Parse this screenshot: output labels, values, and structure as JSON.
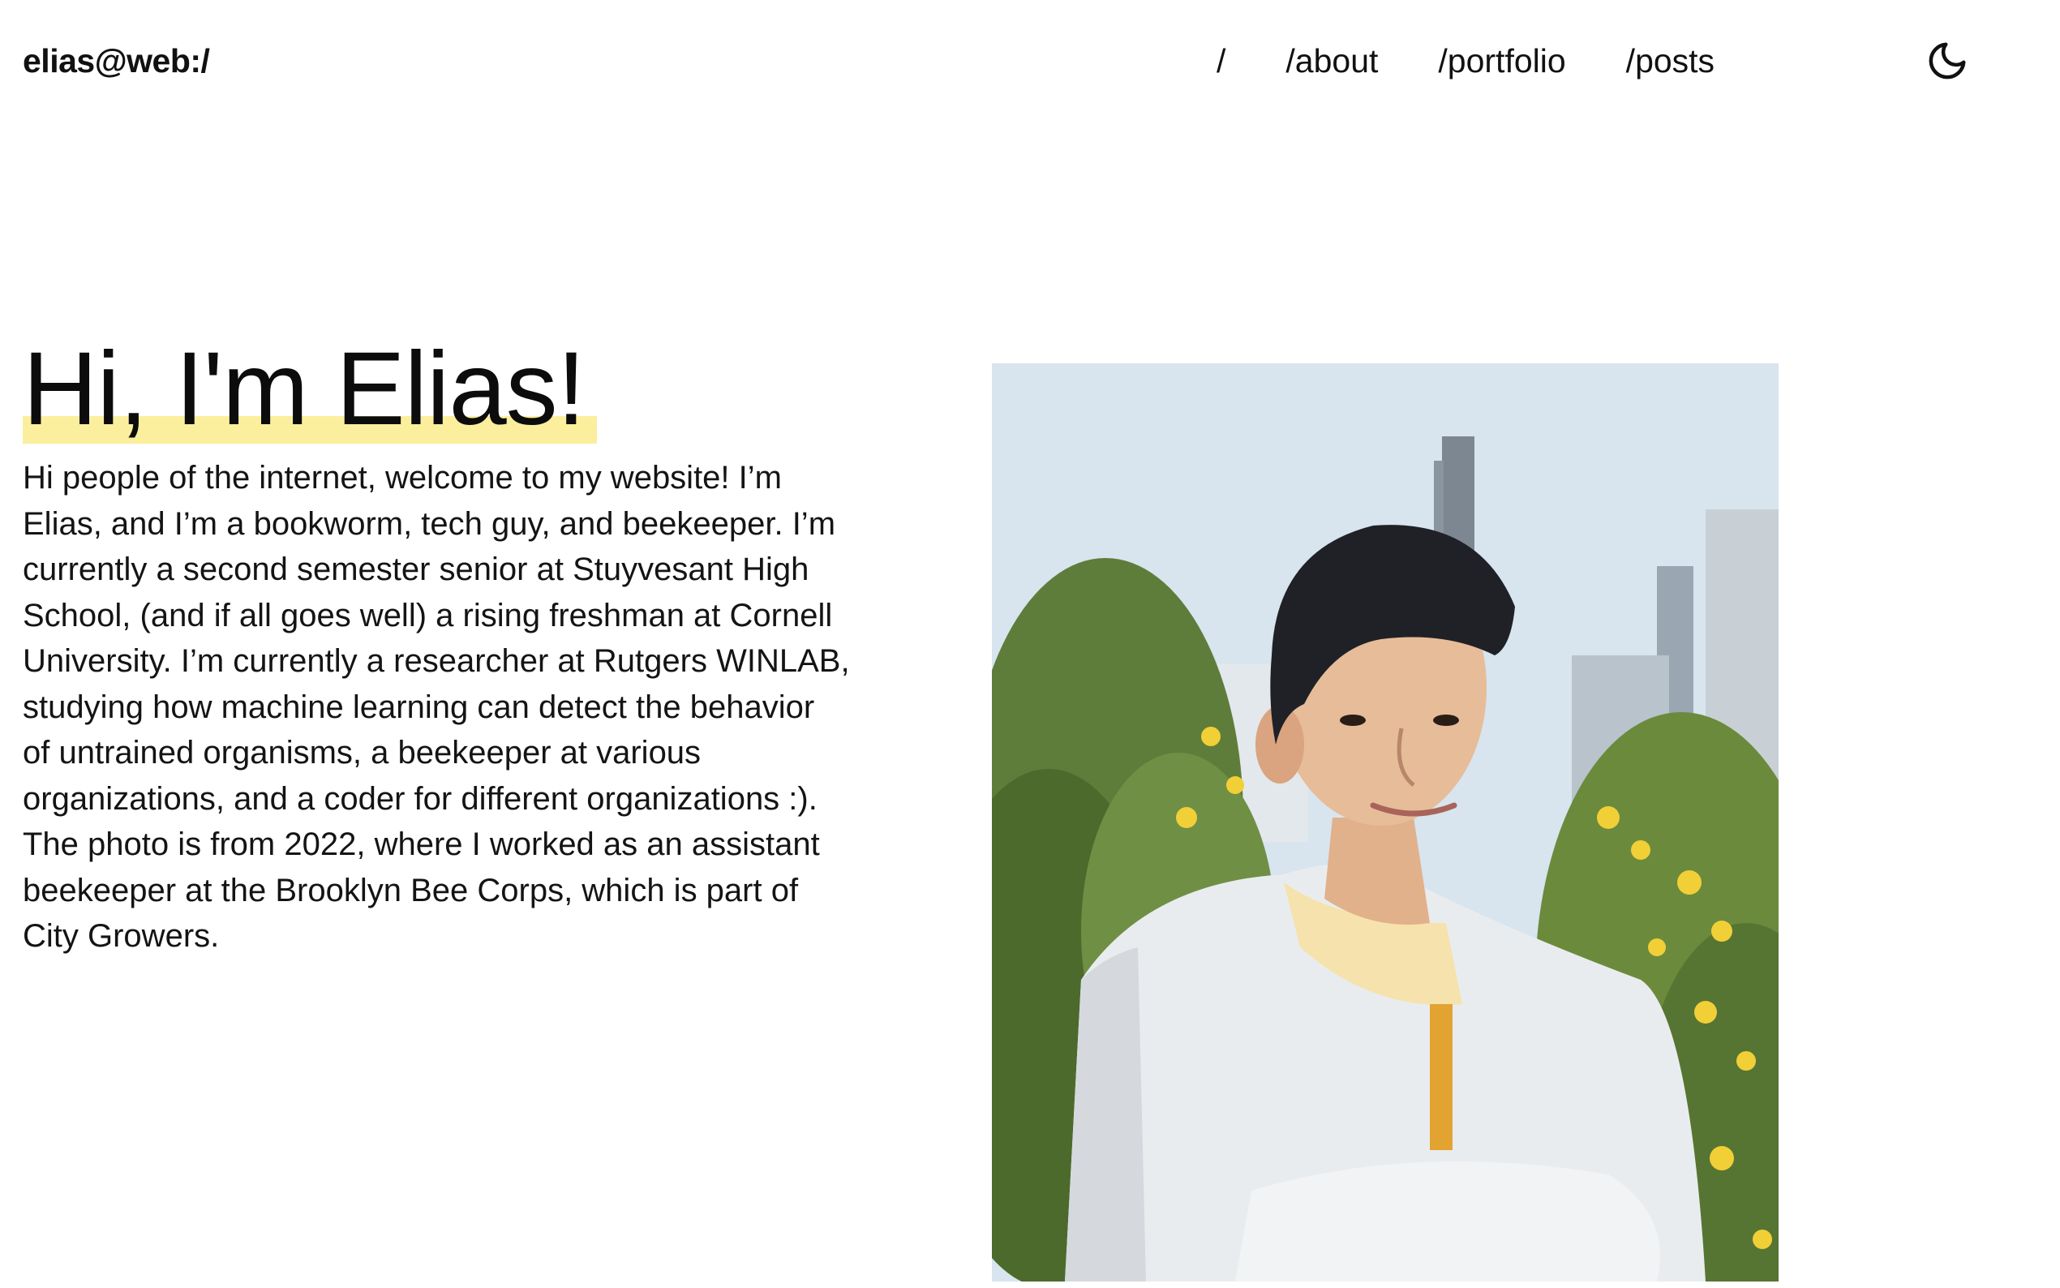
{
  "header": {
    "brand": "elias@web:/",
    "nav": [
      {
        "label": "/"
      },
      {
        "label": "/about"
      },
      {
        "label": "/portfolio"
      },
      {
        "label": "/posts"
      }
    ],
    "theme_toggle_icon": "moon-icon"
  },
  "hero": {
    "title": "Hi, I'm Elias!",
    "highlight_color": "#fbef9e",
    "body": "Hi people of the internet, welcome to my website! I’m Elias, and I’m a bookworm, tech guy, and beekeeper. I’m currently a second semester senior at Stuyvesant High School, (and if all goes well) a rising freshman at Cornell University. I’m currently a researcher at Rutgers WINLAB, studying how machine learning can detect the behavior of untrained organisms, a beekeeper at various organizations, and a coder for different organizations :). The photo is from 2022, where I worked as an assistant beekeeper at the Brooklyn Bee Corps, which is part of City Growers."
  }
}
